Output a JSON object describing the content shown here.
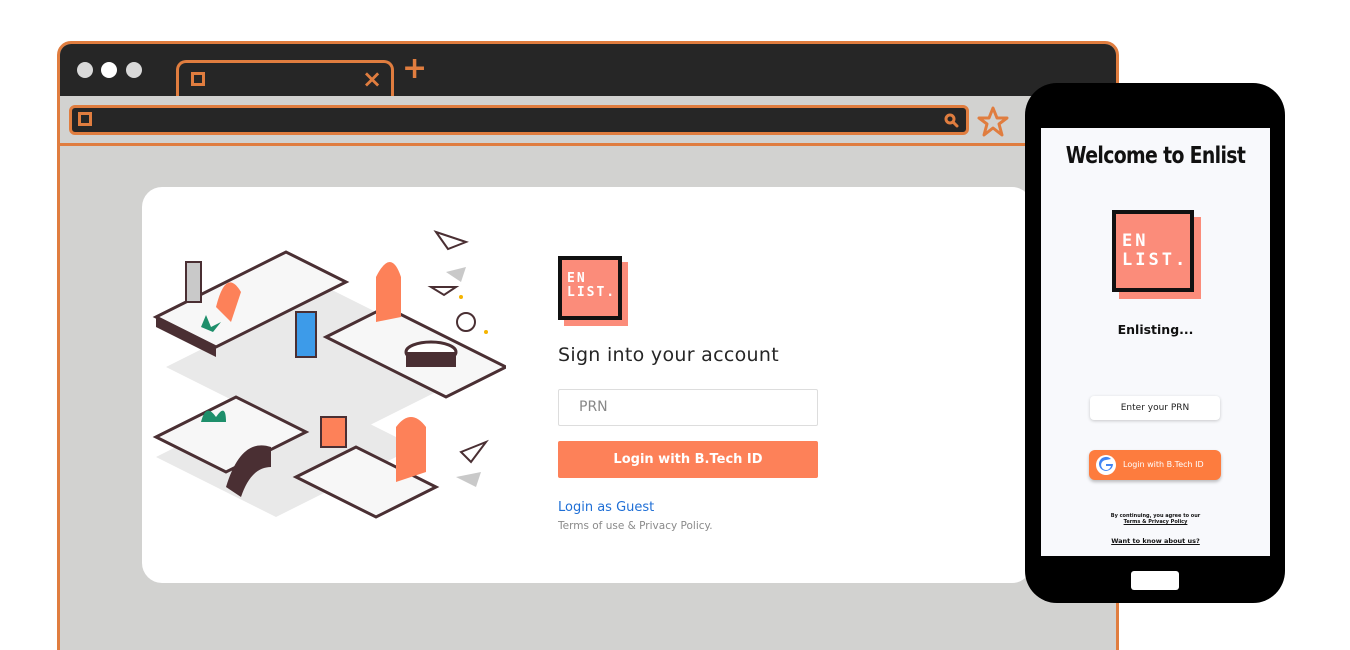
{
  "browser": {
    "tab_close": "×",
    "tab_new": "+"
  },
  "login": {
    "logo_line1": "EN",
    "logo_line2": "LIST.",
    "title": "Sign into your account",
    "prn_placeholder": "PRN",
    "login_button": "Login with B.Tech ID",
    "guest_link": "Login as Guest",
    "terms": "Terms of use & Privacy Policy."
  },
  "mobile": {
    "title": "Welcome to Enlist",
    "logo_line1": "EN",
    "logo_line2": "LIST.",
    "status": "Enlisting...",
    "prn_placeholder": "Enter your PRN",
    "login_button": "Login with B.Tech ID",
    "agree_line1": "By continuing, you agree to our",
    "agree_line2": "Terms & Privacy Policy",
    "about_link": "Want to know about us?"
  },
  "colors": {
    "accent": "#fd8159",
    "frame": "#e07d3f",
    "logo": "#fb8c7a",
    "link": "#1f6fd6"
  },
  "icons": [
    "window-dot-icon",
    "tab-page-icon",
    "close-icon",
    "plus-icon",
    "page-icon",
    "search-icon",
    "star-icon",
    "google-icon"
  ]
}
